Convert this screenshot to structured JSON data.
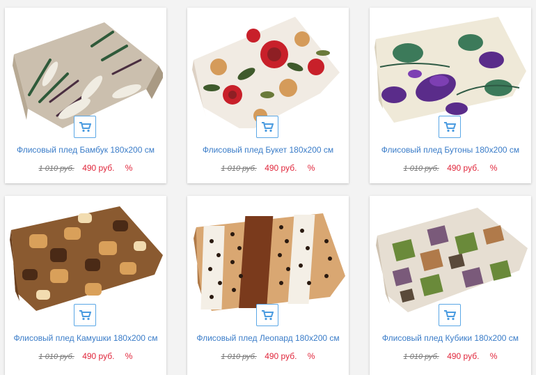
{
  "colors": {
    "link": "#3a7cc8",
    "price": "#e0263b",
    "cart_border": "#5aa7e6"
  },
  "products": [
    {
      "title": "Флисовый плед Бамбук 180х200 см",
      "old_price": "1 010 руб.",
      "price": "490 руб.",
      "discount": "%",
      "image": "blanket-bamboo"
    },
    {
      "title": "Флисовый плед Букет 180х200 см",
      "old_price": "1 010 руб.",
      "price": "490 руб.",
      "discount": "%",
      "image": "blanket-bouquet"
    },
    {
      "title": "Флисовый плед Бутоны 180х200 см",
      "old_price": "1 010 руб.",
      "price": "490 руб.",
      "discount": "%",
      "image": "blanket-buds"
    },
    {
      "title": "Флисовый плед Камушки 180х200 см",
      "old_price": "1 010 руб.",
      "price": "490 руб.",
      "discount": "%",
      "image": "blanket-pebbles"
    },
    {
      "title": "Флисовый плед Леопард 180х200 см",
      "old_price": "1 010 руб.",
      "price": "490 руб.",
      "discount": "%",
      "image": "blanket-leopard"
    },
    {
      "title": "Флисовый плед Кубики 180х200 см",
      "old_price": "1 010 руб.",
      "price": "490 руб.",
      "discount": "%",
      "image": "blanket-cubes"
    }
  ],
  "cart_icon": "shopping-cart-icon"
}
